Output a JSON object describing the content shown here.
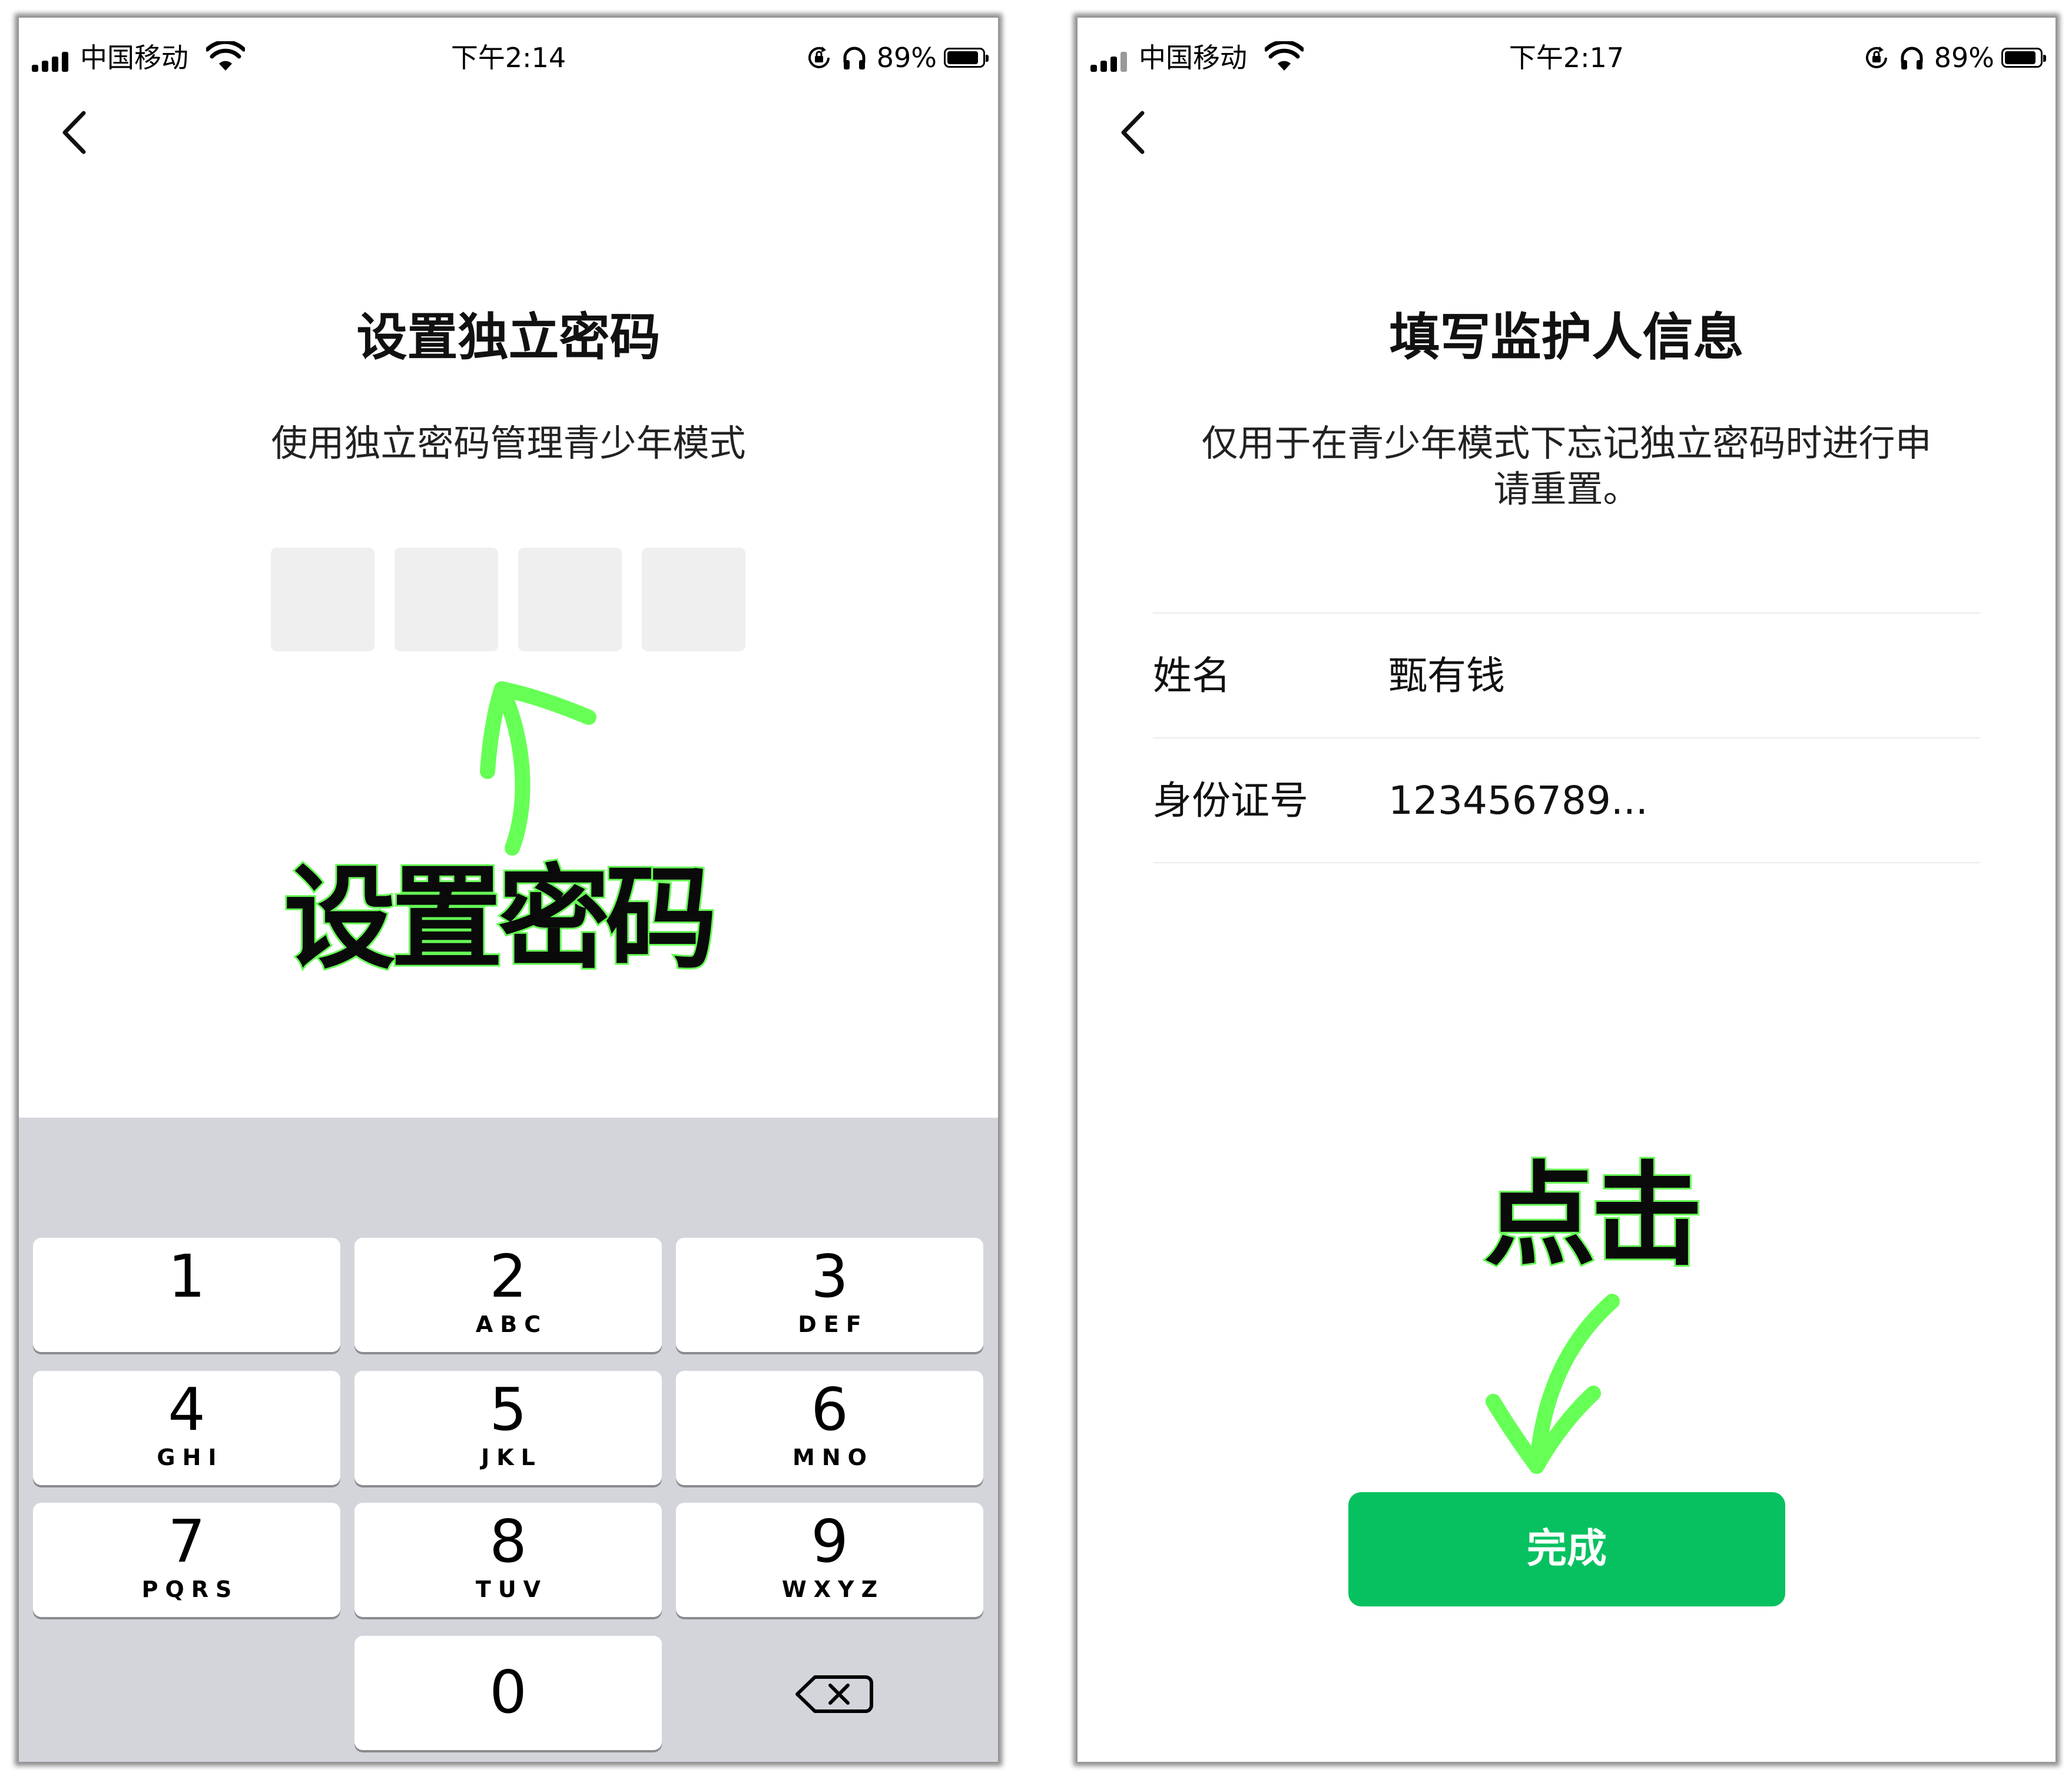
{
  "left_screen": {
    "status_bar": {
      "carrier": "中国移动",
      "time": "下午2:14",
      "battery_percent": "89%",
      "battery_level": 0.89
    },
    "title": "设置独立密码",
    "subtitle": "使用独立密码管理青少年模式",
    "pin_length": 4,
    "annotation": "设置密码",
    "keypad": {
      "keys": [
        {
          "digit": "1",
          "letters": ""
        },
        {
          "digit": "2",
          "letters": "ABC"
        },
        {
          "digit": "3",
          "letters": "DEF"
        },
        {
          "digit": "4",
          "letters": "GHI"
        },
        {
          "digit": "5",
          "letters": "JKL"
        },
        {
          "digit": "6",
          "letters": "MNO"
        },
        {
          "digit": "7",
          "letters": "PQRS"
        },
        {
          "digit": "8",
          "letters": "TUV"
        },
        {
          "digit": "9",
          "letters": "WXYZ"
        }
      ],
      "zero": "0"
    }
  },
  "right_screen": {
    "status_bar": {
      "carrier": "中国移动",
      "time": "下午2:17",
      "battery_percent": "89%",
      "battery_level": 0.89
    },
    "title": "填写监护人信息",
    "subtitle_line1": "仅用于在青少年模式下忘记独立密码时进行申",
    "subtitle_line2": "请重置。",
    "form": {
      "name_label": "姓名",
      "name_value": "甄有钱",
      "id_label": "身份证号",
      "id_value": "123456789..."
    },
    "annotation": "点击",
    "done_button": "完成"
  },
  "colors": {
    "primary_green": "#07c160",
    "annotation_green": "#66ff55",
    "keypad_background": "#d3d5db",
    "pin_box": "#efefef"
  },
  "icons": [
    "signal-icon",
    "wifi-icon",
    "lock-rotation-icon",
    "headphones-icon",
    "battery-icon",
    "back-chevron-icon",
    "arrow-up-annotation-icon",
    "arrow-down-annotation-icon",
    "backspace-icon"
  ]
}
